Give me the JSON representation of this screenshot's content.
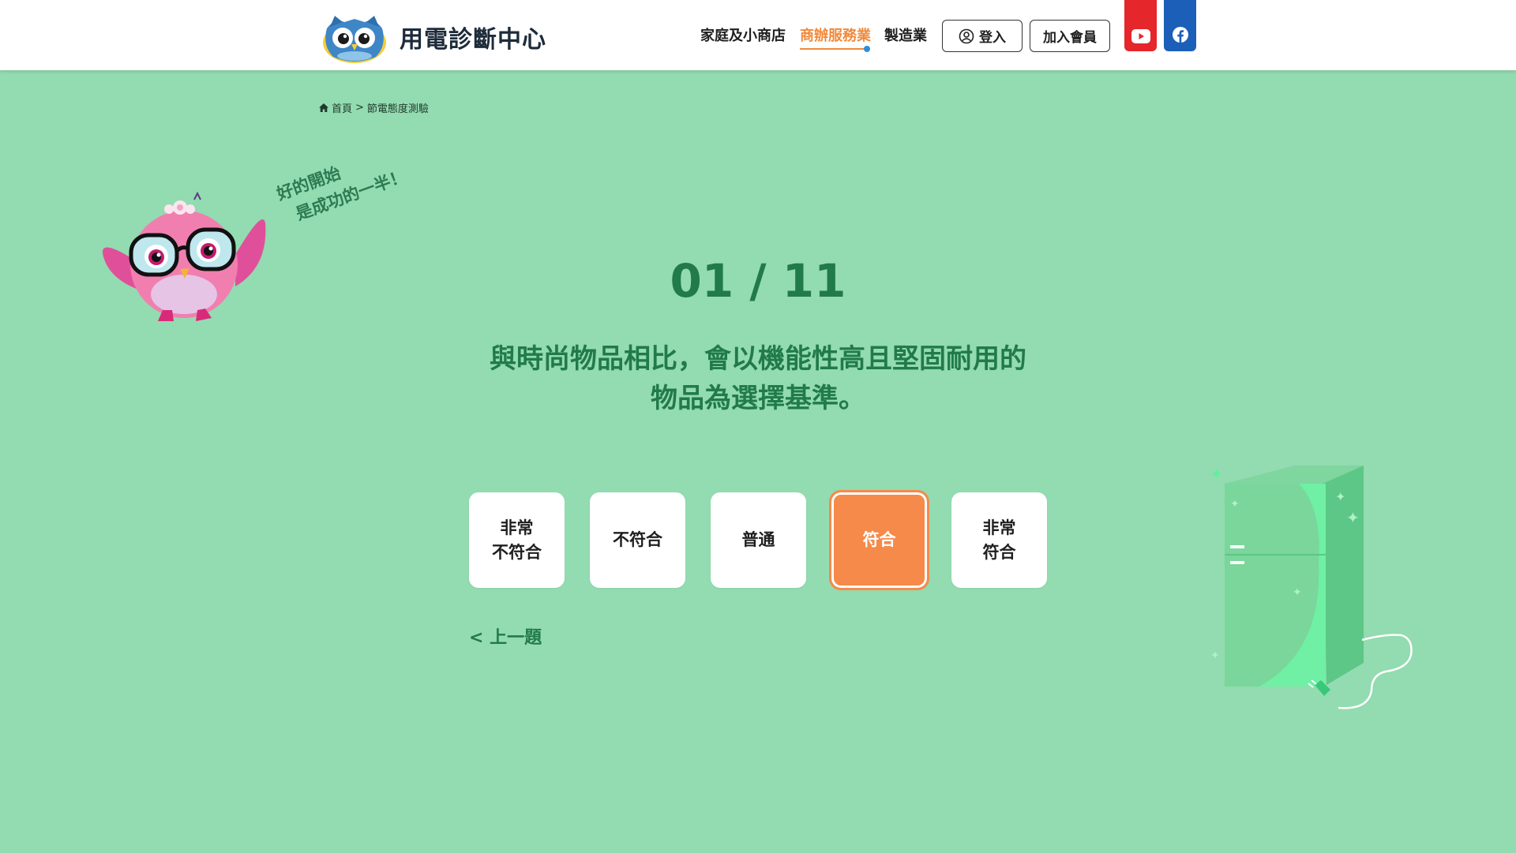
{
  "header": {
    "logo_text": "用電診斷中心",
    "nav": [
      {
        "label": "家庭及小商店",
        "active": false
      },
      {
        "label": "商辦服務業",
        "active": true
      },
      {
        "label": "製造業",
        "active": false
      }
    ],
    "login_label": "登入",
    "join_label": "加入會員",
    "icons": {
      "login": "user-circle-icon",
      "youtube": "youtube-icon",
      "facebook": "facebook-icon"
    },
    "colors": {
      "active_nav": "#f08a3c",
      "youtube": "#e5262a",
      "facebook": "#1b5fb8"
    }
  },
  "breadcrumb": {
    "home_icon": "home-icon",
    "home_label": "首頁",
    "separator": ">",
    "current": "節電態度測驗"
  },
  "mascot": {
    "line1": "好的開始",
    "line2": "是成功的一半！"
  },
  "quiz": {
    "current": "01",
    "divider": "/",
    "total": "11",
    "question_line1": "與時尚物品相比，會以機能性高且堅固耐用的",
    "question_line2": "物品為選擇基準。",
    "options": [
      {
        "label": "非常\n不符合",
        "selected": false
      },
      {
        "label": "不符合",
        "selected": false
      },
      {
        "label": "普通",
        "selected": false
      },
      {
        "label": "符合",
        "selected": true
      },
      {
        "label": "非常\n符合",
        "selected": false
      }
    ],
    "prev_label": "< 上一題",
    "colors": {
      "background": "#93dbb0",
      "text": "#217a4a",
      "selected_option": "#f58a4a"
    }
  }
}
